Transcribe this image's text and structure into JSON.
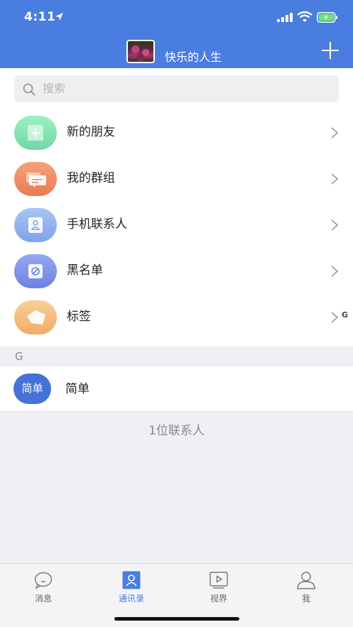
{
  "status_bar": {
    "time": "4:11"
  },
  "header": {
    "title": "快乐的人生"
  },
  "search": {
    "placeholder": "搜索"
  },
  "menu": [
    {
      "label": "新的朋友",
      "icon": "new-friend-icon",
      "color": "#7ddfae"
    },
    {
      "label": "我的群组",
      "icon": "group-chat-icon",
      "color": "#ef8a62"
    },
    {
      "label": "手机联系人",
      "icon": "phone-contact-icon",
      "color": "#8fb2ee"
    },
    {
      "label": "黑名单",
      "icon": "blacklist-icon",
      "color": "#7e95ea"
    },
    {
      "label": "标签",
      "icon": "tag-icon",
      "color": "#f3be7e"
    }
  ],
  "index_letter": "G",
  "section": {
    "letter": "G"
  },
  "contacts": [
    {
      "avatar_text": "简单",
      "name": "简单"
    }
  ],
  "contact_count": "1位联系人",
  "tabs": [
    {
      "label": "消息",
      "icon": "message-icon",
      "active": false
    },
    {
      "label": "通讯录",
      "icon": "contacts-icon",
      "active": true
    },
    {
      "label": "视界",
      "icon": "video-icon",
      "active": false
    },
    {
      "label": "我",
      "icon": "profile-icon",
      "active": false
    }
  ],
  "colors": {
    "primary": "#4a7de0",
    "background": "#efeff4"
  }
}
